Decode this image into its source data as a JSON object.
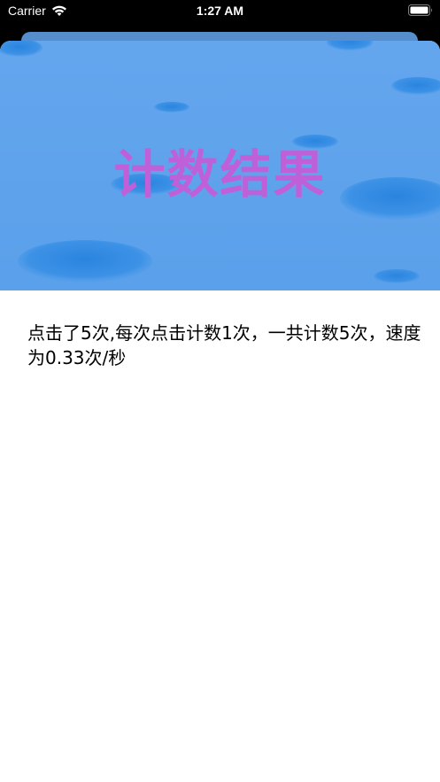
{
  "status_bar": {
    "carrier": "Carrier",
    "time": "1:27 AM",
    "wifi_icon": "wifi-icon",
    "battery_icon": "battery-icon"
  },
  "banner": {
    "title": "计数结果",
    "title_color": "#c060d8",
    "background_color": "#5ea3ec"
  },
  "result": {
    "text": "点击了5次,每次点击计数1次，一共计数5次，速度为0.33次/秒"
  }
}
